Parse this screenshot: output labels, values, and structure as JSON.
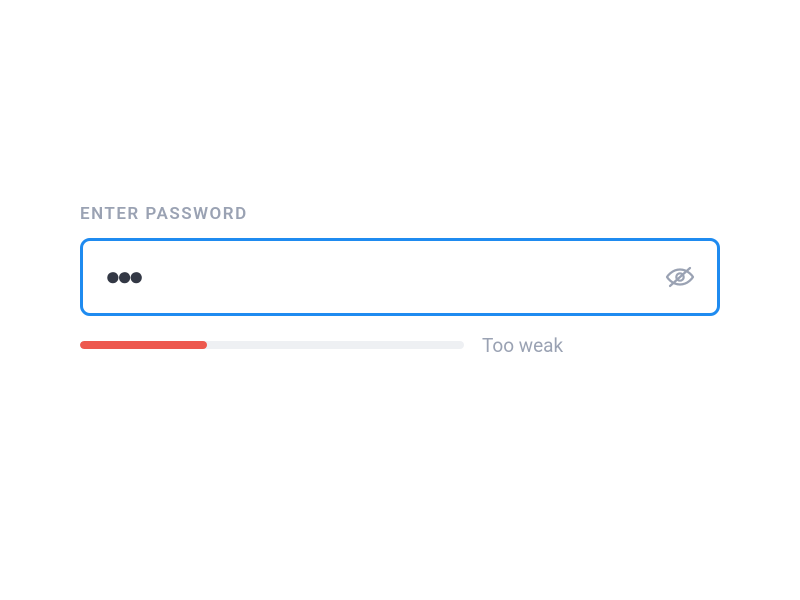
{
  "form": {
    "label": "ENTER PASSWORD",
    "password_value": "●●●",
    "password_masked": true,
    "strength": {
      "percent": 33,
      "label": "Too weak",
      "color": "#ed584e"
    }
  },
  "colors": {
    "border_focus": "#1f8bf0",
    "text_muted": "#9aa2b3",
    "bar_bg": "#eef0f3"
  }
}
